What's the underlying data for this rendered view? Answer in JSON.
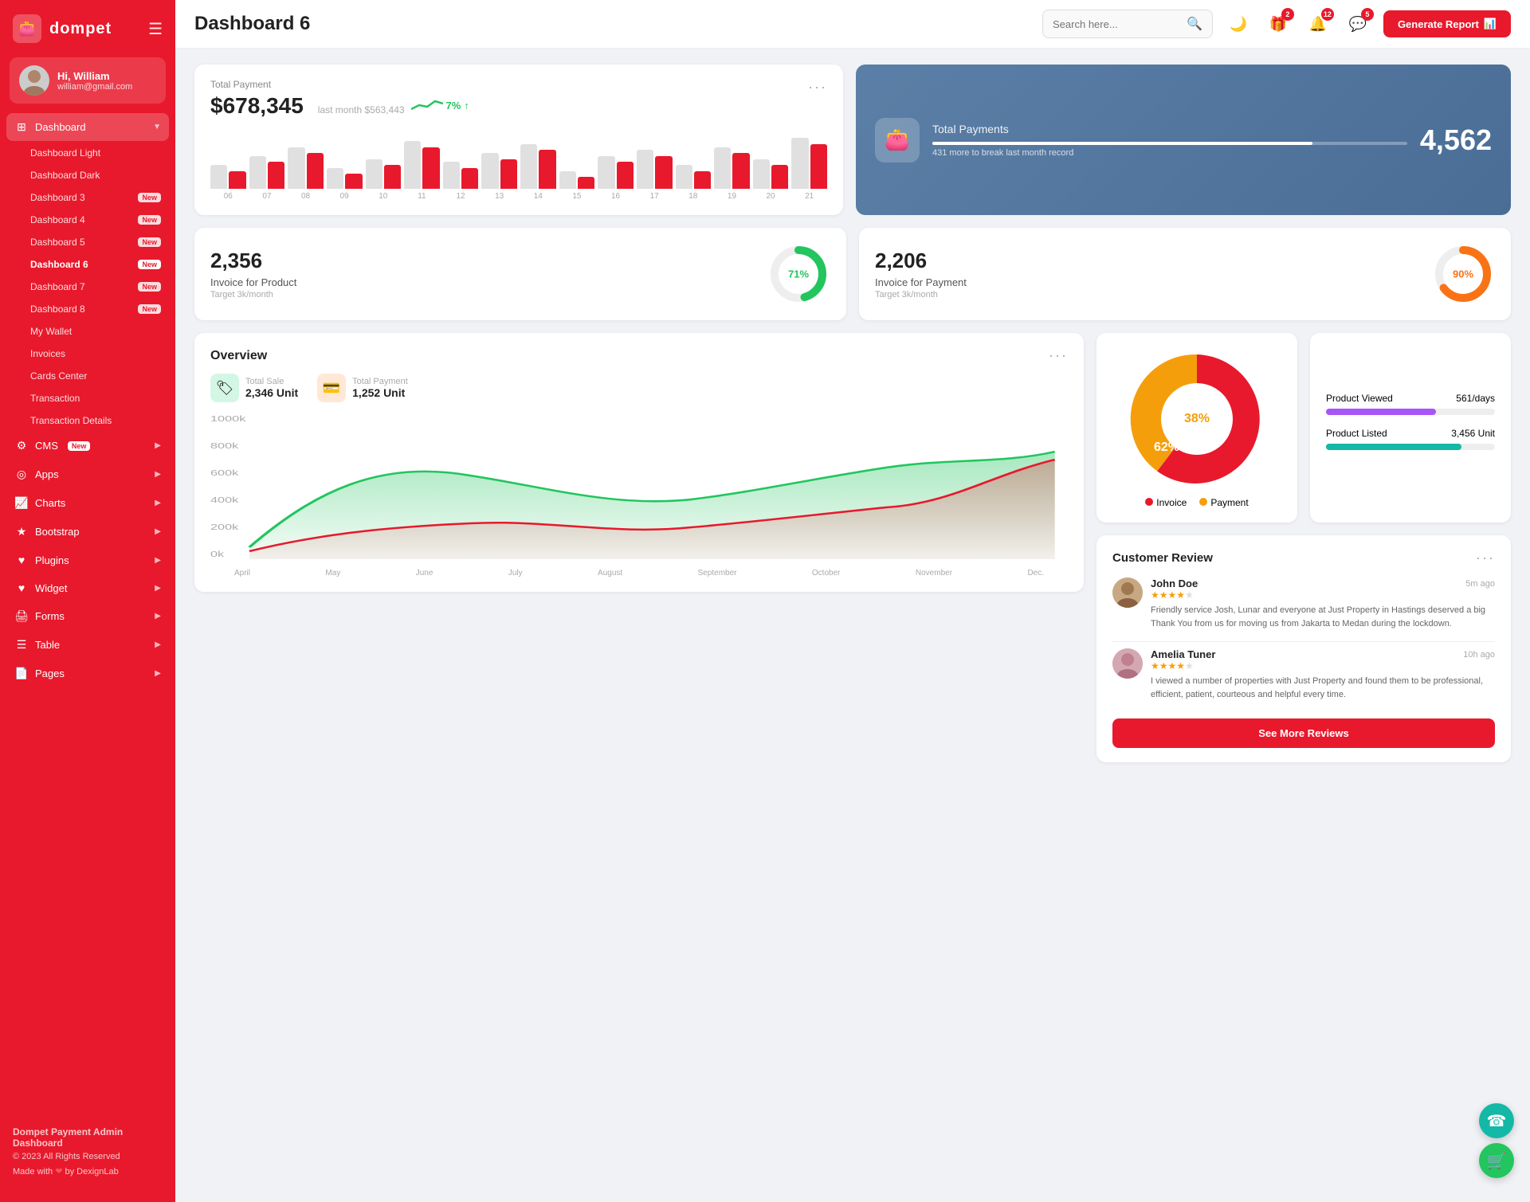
{
  "sidebar": {
    "logo": "dompet",
    "hamburger": "☰",
    "user": {
      "name": "Hi, William",
      "email": "william@gmail.com"
    },
    "nav_main": {
      "label": "Dashboard",
      "icon": "⊞",
      "arrow": "▼"
    },
    "nav_sub": [
      {
        "label": "Dashboard Light",
        "badge": ""
      },
      {
        "label": "Dashboard Dark",
        "badge": ""
      },
      {
        "label": "Dashboard 3",
        "badge": "New"
      },
      {
        "label": "Dashboard 4",
        "badge": "New"
      },
      {
        "label": "Dashboard 5",
        "badge": "New"
      },
      {
        "label": "Dashboard 6",
        "badge": "New",
        "active": true
      },
      {
        "label": "Dashboard 7",
        "badge": "New"
      },
      {
        "label": "Dashboard 8",
        "badge": "New"
      },
      {
        "label": "My Wallet",
        "badge": ""
      },
      {
        "label": "Invoices",
        "badge": ""
      },
      {
        "label": "Cards Center",
        "badge": ""
      },
      {
        "label": "Transaction",
        "badge": ""
      },
      {
        "label": "Transaction Details",
        "badge": ""
      }
    ],
    "nav_items": [
      {
        "label": "CMS",
        "icon": "⚙",
        "badge": "New",
        "arrow": "▶"
      },
      {
        "label": "Apps",
        "icon": "◎",
        "arrow": "▶"
      },
      {
        "label": "Charts",
        "icon": "📈",
        "arrow": "▶"
      },
      {
        "label": "Bootstrap",
        "icon": "★",
        "arrow": "▶"
      },
      {
        "label": "Plugins",
        "icon": "♥",
        "arrow": "▶"
      },
      {
        "label": "Widget",
        "icon": "♥",
        "arrow": "▶"
      },
      {
        "label": "Forms",
        "icon": "🖨",
        "arrow": "▶"
      },
      {
        "label": "Table",
        "icon": "☰",
        "arrow": "▶"
      },
      {
        "label": "Pages",
        "icon": "📄",
        "arrow": "▶"
      }
    ],
    "footer": {
      "title": "Dompet Payment Admin Dashboard",
      "copy": "© 2023 All Rights Reserved",
      "made": "Made with ❤ by DexignLab"
    }
  },
  "topbar": {
    "title": "Dashboard 6",
    "search_placeholder": "Search here...",
    "badges": {
      "gift": "2",
      "bell": "12",
      "chat": "5"
    },
    "generate_btn": "Generate Report"
  },
  "total_payment": {
    "title": "Total Payment",
    "amount": "$678,345",
    "last_month": "last month $563,443",
    "trend": "7%",
    "trend_up": true,
    "more": "···",
    "bars": [
      {
        "gray": 40,
        "red": 30
      },
      {
        "gray": 55,
        "red": 45
      },
      {
        "gray": 70,
        "red": 60
      },
      {
        "gray": 35,
        "red": 25
      },
      {
        "gray": 50,
        "red": 40
      },
      {
        "gray": 80,
        "red": 70
      },
      {
        "gray": 45,
        "red": 35
      },
      {
        "gray": 60,
        "red": 50
      },
      {
        "gray": 75,
        "red": 65
      },
      {
        "gray": 30,
        "red": 20
      },
      {
        "gray": 55,
        "red": 45
      },
      {
        "gray": 65,
        "red": 55
      },
      {
        "gray": 40,
        "red": 30
      },
      {
        "gray": 70,
        "red": 60
      },
      {
        "gray": 50,
        "red": 40
      },
      {
        "gray": 85,
        "red": 75
      }
    ],
    "labels": [
      "06",
      "07",
      "08",
      "09",
      "10",
      "11",
      "12",
      "13",
      "14",
      "15",
      "16",
      "17",
      "18",
      "19",
      "20",
      "21"
    ]
  },
  "total_payments_blue": {
    "title": "Total Payments",
    "sub": "431 more to break last month record",
    "number": "4,562",
    "bar_percent": 80
  },
  "invoice_product": {
    "number": "2,356",
    "label": "Invoice for Product",
    "target": "Target 3k/month",
    "percent": 71,
    "color": "#22c55e"
  },
  "invoice_payment": {
    "number": "2,206",
    "label": "Invoice for Payment",
    "target": "Target 3k/month",
    "percent": 90,
    "color": "#f97316"
  },
  "overview": {
    "title": "Overview",
    "more": "···",
    "total_sale": {
      "label": "Total Sale",
      "value": "2,346 Unit"
    },
    "total_payment": {
      "label": "Total Payment",
      "value": "1,252 Unit"
    },
    "y_labels": [
      "1000k",
      "800k",
      "600k",
      "400k",
      "200k",
      "0k"
    ],
    "x_labels": [
      "April",
      "May",
      "June",
      "July",
      "August",
      "September",
      "October",
      "November",
      "Dec."
    ]
  },
  "pie_chart": {
    "invoice_pct": 62,
    "payment_pct": 38,
    "invoice_label": "Invoice",
    "payment_label": "Payment",
    "invoice_color": "#e8192c",
    "payment_color": "#f59e0b"
  },
  "product_stats": {
    "viewed": {
      "label": "Product Viewed",
      "value": "561/days",
      "percent": 65
    },
    "listed": {
      "label": "Product Listed",
      "value": "3,456 Unit",
      "percent": 80
    }
  },
  "customer_review": {
    "title": "Customer Review",
    "more": "···",
    "reviews": [
      {
        "name": "John Doe",
        "time": "5m ago",
        "stars": 4,
        "text": "Friendly service Josh, Lunar and everyone at Just Property in Hastings deserved a big Thank You from us for moving us from Jakarta to Medan during the lockdown."
      },
      {
        "name": "Amelia Tuner",
        "time": "10h ago",
        "stars": 4,
        "text": "I viewed a number of properties with Just Property and found them to be professional, efficient, patient, courteous and helpful every time."
      }
    ],
    "see_more_btn": "See More Reviews"
  },
  "floating": {
    "support_icon": "☎",
    "cart_icon": "🛒"
  }
}
